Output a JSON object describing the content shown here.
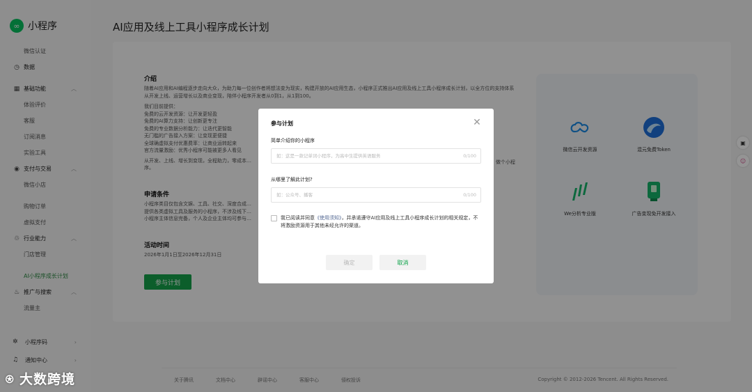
{
  "app": {
    "name": "小程序"
  },
  "sidebar": {
    "items": [
      {
        "label": "微信认证",
        "type": "sub"
      },
      {
        "label": "数据",
        "type": "group",
        "icon": "chart-icon"
      },
      {
        "label": "基础功能",
        "type": "group",
        "icon": "grid-icon",
        "expanded": true
      },
      {
        "label": "体验评价",
        "type": "sub"
      },
      {
        "label": "客服",
        "type": "sub"
      },
      {
        "label": "订阅消息",
        "type": "sub"
      },
      {
        "label": "实验工具",
        "type": "sub"
      },
      {
        "label": "支付与交易",
        "type": "group",
        "icon": "pay-icon",
        "expanded": true
      },
      {
        "label": "微信小店",
        "type": "sub"
      },
      {
        "label": "购物订单",
        "type": "sub"
      },
      {
        "label": "虚拟支付",
        "type": "sub"
      },
      {
        "label": "行业能力",
        "type": "group",
        "icon": "industry-icon",
        "expanded": true
      },
      {
        "label": "门店管理",
        "type": "sub"
      },
      {
        "label": "AI小程序成长计划",
        "type": "sub",
        "active": true
      },
      {
        "label": "推广与搜索",
        "type": "group",
        "icon": "promote-icon",
        "expanded": true
      },
      {
        "label": "流量主",
        "type": "sub"
      }
    ],
    "bottom": [
      {
        "label": "小程序码",
        "icon": "qrcode-icon"
      },
      {
        "label": "通知中心",
        "icon": "bell-icon"
      }
    ]
  },
  "watermark": "大数跨境",
  "page": {
    "title": "AI应用及线上工具小程序成长计划",
    "intro_title": "介绍",
    "intro_text": "随着AI应用和AI编程逐步走向大众，为助力每一位创作者将想法变为现实，构建开放的AI应用生态，小程序正式推出AI应用及线上工具小程序成长计划，以全方位的支持体系从开发上线、运营增长以及商业变现，陪伴小程序开发者从0到1，从1到100。",
    "provide_title": "我们目前提供：",
    "provide_items": [
      "免费的云开发资源：让开发更轻盈",
      "免费的AI算力支持：让创新更专注",
      "免费的专业数据分析能力：让迭代更智能",
      "无门槛的广告接入方案：让变现更便捷",
      "全球确虚拟支付优惠费率：让商业运转起来",
      "官方流量激励：优秀小程序可能被更多人看见"
    ],
    "provide_tail": "从开发、上线、增长到变现，全程助力，零成本…",
    "provide_tail_right": "做个小程",
    "provide_tail_2": "序。",
    "apply_title": "申请条件",
    "apply_lines": [
      "小程序类目仅包含文娱、工具、社交、深度合成…",
      "提供各类虚拟工具及服务的小程序，不涉及线下…",
      "小程序主体信息完备，个人及企业主体均可参与…"
    ],
    "time_title": "活动时间",
    "time_text": "2026年1月1日至2026年12月31日",
    "join_button": "参与计划"
  },
  "resources": [
    {
      "label": "微信云开发资源",
      "icon": "cloud-icon"
    },
    {
      "label": "混元免费Token",
      "icon": "hunyuan-icon"
    },
    {
      "label": "We分析专业版",
      "icon": "analytics-icon"
    },
    {
      "label": "广告变现免开发接入",
      "icon": "ad-icon"
    }
  ],
  "footer": {
    "links": [
      "关于腾讯",
      "文档中心",
      "辟谣中心",
      "客服中心",
      "侵权投诉"
    ],
    "copyright": "Copyright © 2012-2026 Tencent. All Rights Reserved."
  },
  "modal": {
    "title": "参与计划",
    "field1_label": "简单介绍你的小程序",
    "field1_placeholder": "如：这是一款记单词小程序，为高中生提供英语服务",
    "field1_count": "0/100",
    "field2_label": "从哪里了解此计划?",
    "field2_placeholder": "如：公众号、播客",
    "field2_count": "0/100",
    "agree_prefix": "我已阅读并同意",
    "agree_link": "《使用须知》",
    "agree_suffix": "，并承诺遵守AI应用及线上工具小程序成长计划的相关规定，不将激励资源用于其他未经允许的渠道。",
    "confirm": "确定",
    "cancel": "取消"
  },
  "colors": {
    "brand": "#07c160",
    "primary_button": "#15a34a",
    "link": "#576b95"
  }
}
